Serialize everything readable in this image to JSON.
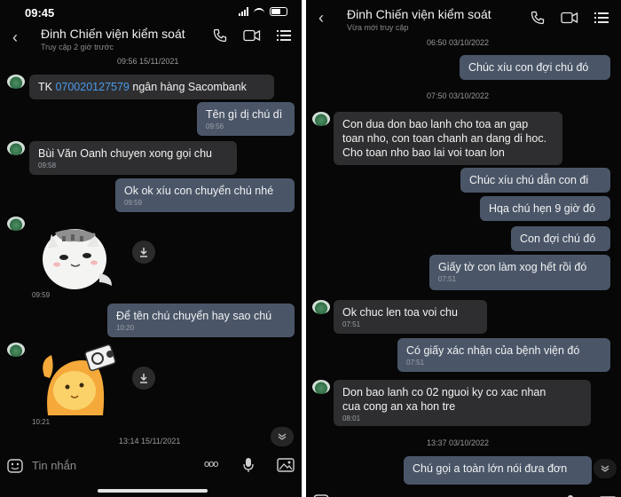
{
  "left": {
    "status": {
      "time": "09:45"
    },
    "header": {
      "back": "‹",
      "name": "Đinh Chiến viện kiểm soát",
      "subtitle": "Truy cập 2 giờ trước"
    },
    "timestamps": [
      "09:56 15/11/2021",
      "13:14 15/11/2021"
    ],
    "messages": [
      {
        "dir": "in",
        "prefix": "TK ",
        "link": "070020127579",
        "suffix": " ngân hàng Sacombank"
      },
      {
        "dir": "out",
        "text": "Tên gì dị chú dì",
        "time": "09:56"
      },
      {
        "dir": "in",
        "text": "Bùi Văn Oanh chuyen xong gọi chu",
        "time": "09:58"
      },
      {
        "dir": "out",
        "text": "Ok ok xíu con chuyển chú nhé",
        "time": "09:59"
      },
      {
        "dir": "out",
        "text": "Để tên chú chuyển hay sao chú",
        "time": "10:20"
      }
    ],
    "sticker_times": [
      "09:59",
      "10:21"
    ],
    "input": {
      "placeholder": "Tin nhắn",
      "more": "ooo"
    }
  },
  "right": {
    "header": {
      "back": "‹",
      "name": "Đinh Chiến viện kiểm soát",
      "subtitle": "Vừa mới truy cập"
    },
    "timestamps": [
      "06:50 03/10/2022",
      "07:50 03/10/2022",
      "13:37 03/10/2022"
    ],
    "messages": [
      {
        "dir": "out",
        "text": "Chúc xíu con đợi chú đó"
      },
      {
        "dir": "in",
        "lines": [
          "Con dua don bao lanh cho toa an gap",
          "toan nho, con toan chanh an dang di hoc.",
          "Cho toan nho bao lai voi toan lon"
        ]
      },
      {
        "dir": "out",
        "text": "Chúc xíu chú dẫn con đi"
      },
      {
        "dir": "out",
        "text": "Hqa chú hẹn 9 giờ đó"
      },
      {
        "dir": "out",
        "text": "Con đợi chú đó"
      },
      {
        "dir": "out",
        "text": "Giấy tờ con làm xog hết rồi đó",
        "time": "07:51"
      },
      {
        "dir": "in",
        "text": "Ok chuc len toa voi chu",
        "time": "07:51"
      },
      {
        "dir": "out",
        "text": "Có giấy xác nhận của bệnh viện đó",
        "time": "07:51"
      },
      {
        "dir": "in",
        "lines": [
          "Don bao lanh co 02 nguoi ky co xac nhan",
          "cua cong an xa hon tre"
        ],
        "time": "08:01"
      },
      {
        "dir": "out",
        "text": "Chú gọi a toàn lớn nói đưa đơn"
      }
    ]
  },
  "colors": {
    "background": "#070707",
    "incoming": "#2e2e30",
    "outgoing": "#4a5668",
    "link": "#4a9ae8"
  },
  "icons": [
    "back-arrow-icon",
    "phone-icon",
    "video-call-icon",
    "menu-list-icon",
    "download-icon",
    "scroll-down-icon",
    "emoji-icon",
    "microphone-icon",
    "image-icon"
  ]
}
